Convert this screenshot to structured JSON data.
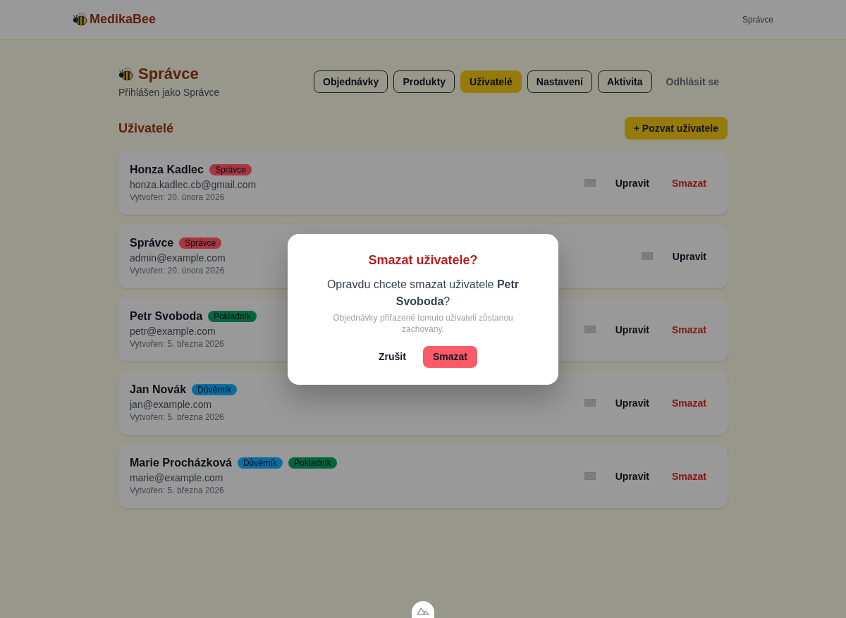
{
  "header": {
    "logo": "MedikaBee",
    "user": "Správce"
  },
  "page": {
    "title": "Správce",
    "subtitle": "Přihlášen jako Správce"
  },
  "nav": {
    "tabs": [
      {
        "label": "Objednávky",
        "selected": false
      },
      {
        "label": "Produkty",
        "selected": false
      },
      {
        "label": "Uživatelé",
        "selected": true
      },
      {
        "label": "Nastavení",
        "selected": false
      },
      {
        "label": "Aktivita",
        "selected": false
      }
    ],
    "logout": "Odhlásit se"
  },
  "users_section": {
    "title": "Uživatelé",
    "invite_button": "+ Pozvat uživatele",
    "users": [
      {
        "name": "Honza Kadlec",
        "roles": [
          {
            "label": "Správce",
            "color": "#a63640"
          }
        ],
        "email": "honza.kadlec.cb@gmail.com",
        "created": "Vytvořen: 20. února 2026",
        "actions": [
          {
            "kind": "edit",
            "label": "Upravit"
          },
          {
            "kind": "delete",
            "label": "Smazat"
          }
        ]
      },
      {
        "name": "Správce",
        "roles": [
          {
            "label": "Správce",
            "color": "#a63640"
          }
        ],
        "email": "admin@example.com",
        "created": "Vytvořen: 20. února 2026",
        "actions": [
          {
            "kind": "edit",
            "label": "Upravit"
          }
        ]
      },
      {
        "name": "Petr Svoboda",
        "roles": [
          {
            "label": "Pokladník",
            "color": "#04653f"
          }
        ],
        "email": "petr@example.com",
        "created": "Vytvořen: 5. března 2026",
        "actions": [
          {
            "kind": "edit",
            "label": "Upravit"
          },
          {
            "kind": "delete",
            "label": "Smazat"
          }
        ]
      },
      {
        "name": "Jan Novák",
        "roles": [
          {
            "label": "Důvěrník",
            "color": "#0a6ea3"
          }
        ],
        "email": "jan@example.com",
        "created": "Vytvořen: 5. března 2026",
        "actions": [
          {
            "kind": "edit",
            "label": "Upravit"
          },
          {
            "kind": "delete",
            "label": "Smazat"
          }
        ]
      },
      {
        "name": "Marie Procházková",
        "roles": [
          {
            "label": "Důvěrník",
            "color": "#0a6ea3"
          },
          {
            "label": "Pokladník",
            "color": "#04653f"
          }
        ],
        "email": "marie@example.com",
        "created": "Vytvořen: 5. března 2026",
        "actions": [
          {
            "kind": "edit",
            "label": "Upravit"
          },
          {
            "kind": "delete",
            "label": "Smazat"
          }
        ]
      }
    ]
  },
  "dialog": {
    "title": "Smazat uživatele?",
    "message": "Opravdu chcete smazat uživatele **Petr Svoboda**?",
    "note": "Objednávky přiřazené tomuto uživateli zůstanou zachovány.",
    "buttons": [
      {
        "kind": "cancel",
        "label": "Zrušit"
      },
      {
        "kind": "danger",
        "label": "Smazat"
      }
    ]
  }
}
